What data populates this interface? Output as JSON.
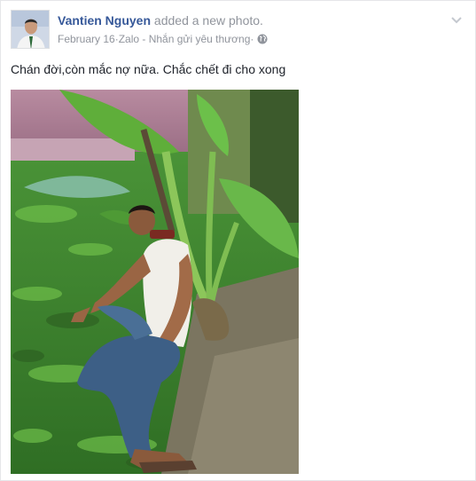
{
  "post": {
    "author": "Vantien Nguyen",
    "action": "added a new photo.",
    "date": "February 16",
    "source": "Zalo - Nhắn gửi yêu thương",
    "separator": " · ",
    "text": "Chán đời,còn mắc nợ nữa. Chắc chết đi cho xong"
  },
  "icons": {
    "audience": "globe-icon",
    "options": "chevron-down-icon"
  },
  "colors": {
    "author_link": "#365899",
    "meta_gray": "#90949c",
    "body_text": "#1d2129"
  }
}
